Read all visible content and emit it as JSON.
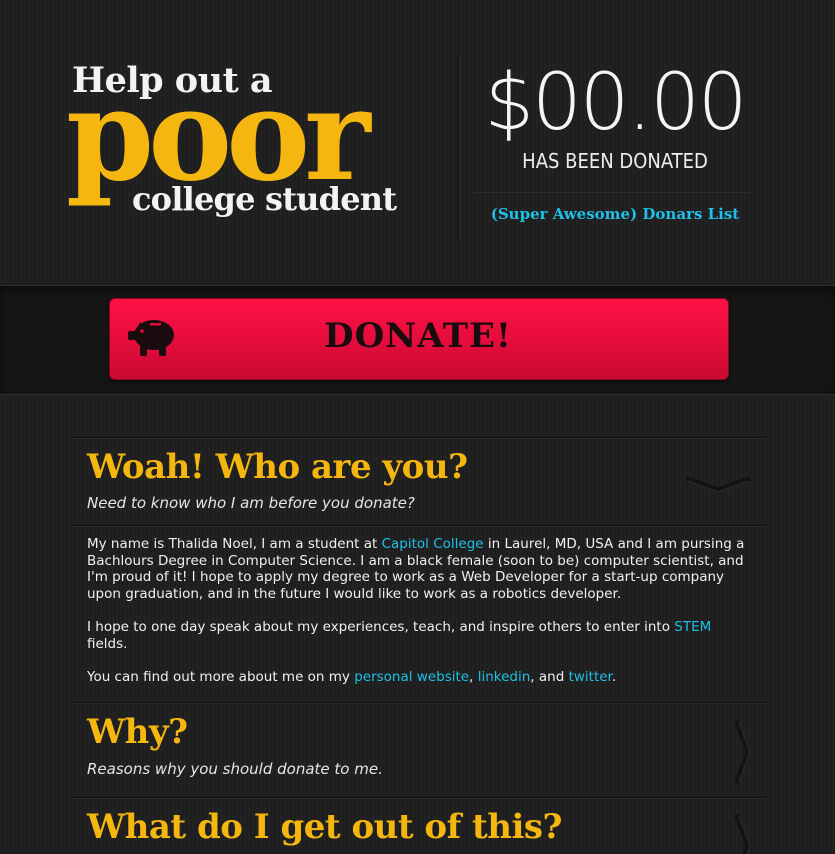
{
  "header": {
    "title_line1": "Help out a",
    "title_big": "poor",
    "title_line3": "college student",
    "amount": "$00.00",
    "amount_caption": "HAS BEEN DONATED",
    "donors_link": "(Super Awesome) Donars List"
  },
  "donate": {
    "label": "DONATE!",
    "icon": "piggy-bank-icon"
  },
  "sections": [
    {
      "title": "Woah! Who are you?",
      "subtitle": "Need to know who I am before you donate?",
      "state": "expanded"
    },
    {
      "title": "Why?",
      "subtitle": "Reasons why you should donate to me.",
      "state": "collapsed"
    },
    {
      "title": "What do I get out of this?",
      "state": "collapsed"
    }
  ],
  "about": {
    "p1_a": "My name is Thalida Noel, I am a student at ",
    "p1_link": "Capitol College",
    "p1_b": " in Laurel, MD, USA and I am pursing a Bachlours Degree in Computer Science.  I am a black female (soon to be) computer scientist, and I'm proud of it!  I hope to apply my degree to work as a Web Developer for a start-up company upon graduation, and in the future I would like to work as a robotics developer.",
    "p2_a": "I hope to one day speak about my experiences, teach, and inspire others to enter into ",
    "p2_link": "STEM",
    "p2_b": " fields.",
    "p3_a": "You can find out more about me on my ",
    "p3_link1": "personal website",
    "p3_sep1": ", ",
    "p3_link2": "linkedin",
    "p3_sep2": ", and ",
    "p3_link3": "twitter",
    "p3_end": "."
  },
  "colors": {
    "accent_yellow": "#f5b70f",
    "link_cyan": "#1ec0e7",
    "donate_red": "#f0103f",
    "background": "#1f1f1f"
  }
}
